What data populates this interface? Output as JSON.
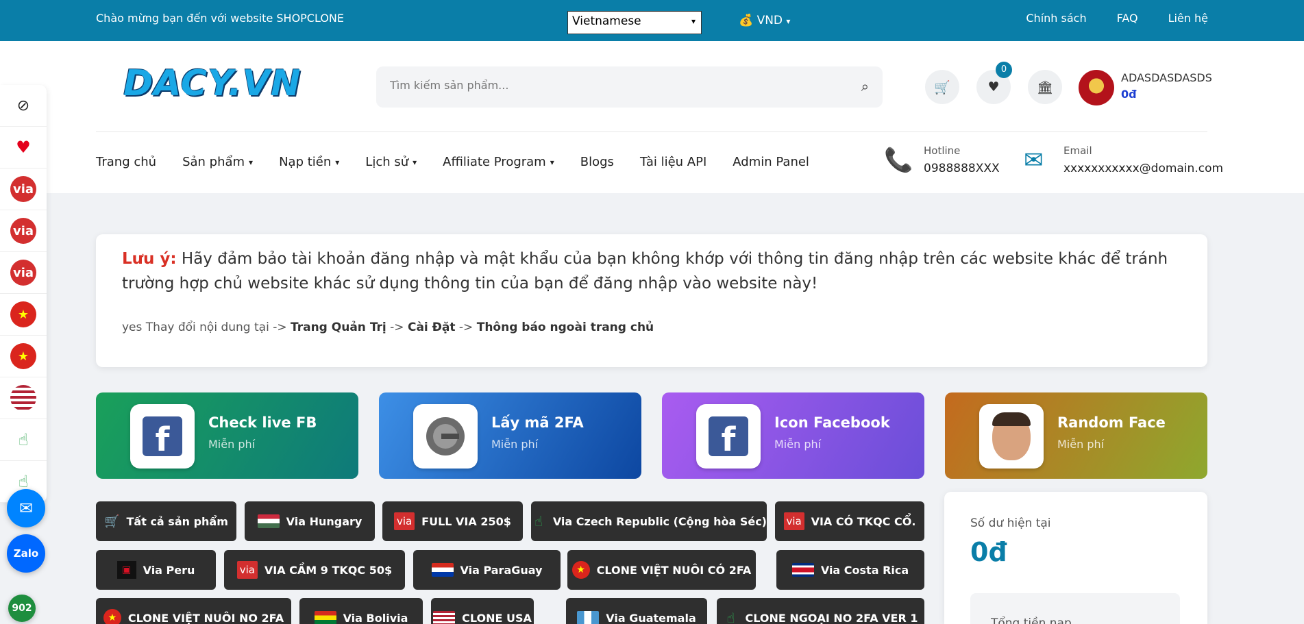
{
  "topbar": {
    "welcome": "Chào mừng bạn đến với website SHOPCLONE",
    "language": "Vietnamese",
    "currency": "VND",
    "links": [
      "Chính sách",
      "FAQ",
      "Liên hệ"
    ]
  },
  "logo": "DACY.VN",
  "search": {
    "placeholder": "Tìm kiếm sản phẩm..."
  },
  "wishlist_count": "0",
  "user": {
    "name": "ADASDASDASDS",
    "balance": "0đ"
  },
  "nav": {
    "items": [
      {
        "label": "Trang chủ",
        "dropdown": false
      },
      {
        "label": "Sản phẩm",
        "dropdown": true
      },
      {
        "label": "Nạp tiền",
        "dropdown": true
      },
      {
        "label": "Lịch sử",
        "dropdown": true
      },
      {
        "label": "Affiliate Program",
        "dropdown": true
      },
      {
        "label": "Blogs",
        "dropdown": false
      },
      {
        "label": "Tài liệu API",
        "dropdown": false
      },
      {
        "label": "Admin Panel",
        "dropdown": false
      }
    ]
  },
  "contact": {
    "hotline_label": "Hotline",
    "hotline": "0988888XXX",
    "email_label": "Email",
    "email": "xxxxxxxxxxx@domain.com"
  },
  "leftbar": [
    "eye-slash",
    "heart",
    "via",
    "via",
    "via",
    "vn",
    "vn",
    "us",
    "tap"
  ],
  "floating": {
    "zalo": "Zalo",
    "number": "902"
  },
  "notice": {
    "label": "Lưu ý:",
    "text": "Hãy đảm bảo tài khoản đăng nhập và mật khẩu của bạn không khớp với thông tin đăng nhập trên các website khác để tránh trường hợp chủ website khác sử dụng thông tin của bạn để đăng nhập vào website này!",
    "sub_img_alt": "yes",
    "sub_text": "Thay đổi nội dung tại ->",
    "path1": "Trang Quản Trị",
    "sep": "->",
    "path2": "Cài Đặt",
    "path3": "Thông báo ngoài trang chủ"
  },
  "tools": [
    {
      "title": "Check live FB",
      "sub": "Miễn phí"
    },
    {
      "title": "Lấy mã 2FA",
      "sub": "Miễn phí"
    },
    {
      "title": "Icon Facebook",
      "sub": "Miễn phí"
    },
    {
      "title": "Random Face",
      "sub": "Miễn phí"
    }
  ],
  "chips": [
    "Tất cả sản phẩm",
    "Via Hungary",
    "FULL VIA 250$",
    "Via Czech Republic (Cộng hòa Séc)",
    "VIA CÓ TKQC CỔ.",
    "Via Peru",
    "VIA CẦM 9 TKQC 50$",
    "Via ParaGuay",
    "CLONE VIỆT NUÔI CÓ 2FA",
    "Via Costa Rica",
    "CLONE VIỆT NUÔI NO 2FA",
    "Via Bolivia",
    "CLONE USA",
    "Via Guatemala",
    "CLONE NGOẠI NO 2FA VER 1"
  ],
  "flag_via_text": "via",
  "balance": {
    "label": "Số dư hiện tại",
    "value": "0đ",
    "total_label": "Tổng tiền nạp"
  },
  "colors": {
    "primary": "#0a7ea8",
    "chip": "#2f2f2f",
    "accent_red": "#d93025"
  }
}
